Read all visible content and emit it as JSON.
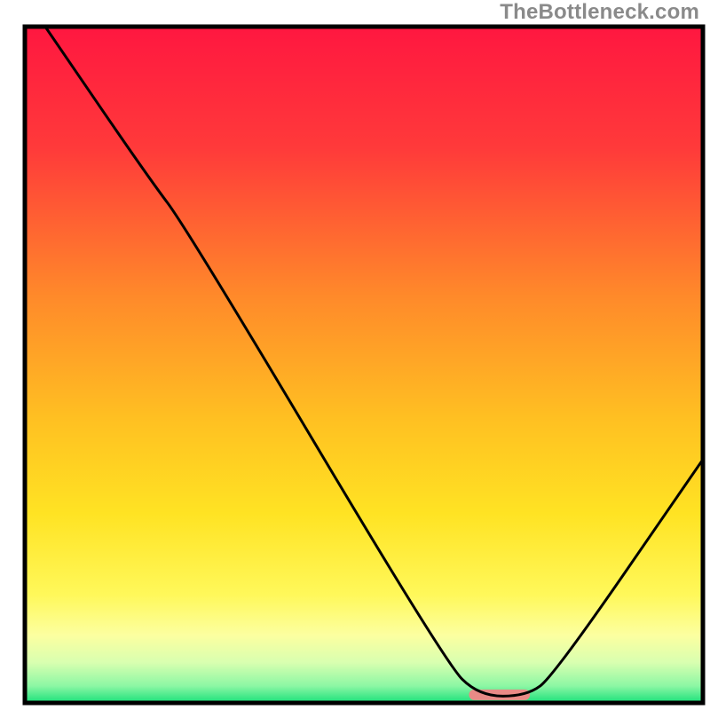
{
  "watermark": "TheBottleneck.com",
  "chart_data": {
    "type": "line",
    "title": "",
    "xlabel": "",
    "ylabel": "",
    "xlim": [
      0,
      100
    ],
    "ylim": [
      0,
      100
    ],
    "grid": false,
    "legend": false,
    "background_gradient": {
      "stops": [
        {
          "offset": 0.0,
          "color": "#ff1740"
        },
        {
          "offset": 0.18,
          "color": "#ff3a3a"
        },
        {
          "offset": 0.4,
          "color": "#ff8a2a"
        },
        {
          "offset": 0.58,
          "color": "#ffc022"
        },
        {
          "offset": 0.72,
          "color": "#ffe323"
        },
        {
          "offset": 0.84,
          "color": "#fff85a"
        },
        {
          "offset": 0.9,
          "color": "#fcffa0"
        },
        {
          "offset": 0.94,
          "color": "#d9ffb0"
        },
        {
          "offset": 0.975,
          "color": "#8cf7a4"
        },
        {
          "offset": 1.0,
          "color": "#18e07a"
        }
      ]
    },
    "series": [
      {
        "name": "bottleneck-curve",
        "stroke": "#000000",
        "points": [
          {
            "x": 3,
            "y": 100
          },
          {
            "x": 18,
            "y": 78
          },
          {
            "x": 24,
            "y": 70
          },
          {
            "x": 62,
            "y": 6
          },
          {
            "x": 67,
            "y": 1
          },
          {
            "x": 74,
            "y": 1
          },
          {
            "x": 78,
            "y": 4
          },
          {
            "x": 100,
            "y": 36
          }
        ]
      }
    ],
    "marker": {
      "name": "optimal-range-marker",
      "x_center": 70,
      "y": 1.2,
      "width": 9,
      "color": "#e98a86"
    },
    "axes": {
      "left": {
        "x": 3,
        "y0": 3,
        "y1": 99
      },
      "bottom": {
        "y": 99,
        "x0": 3,
        "x1": 99
      }
    }
  }
}
